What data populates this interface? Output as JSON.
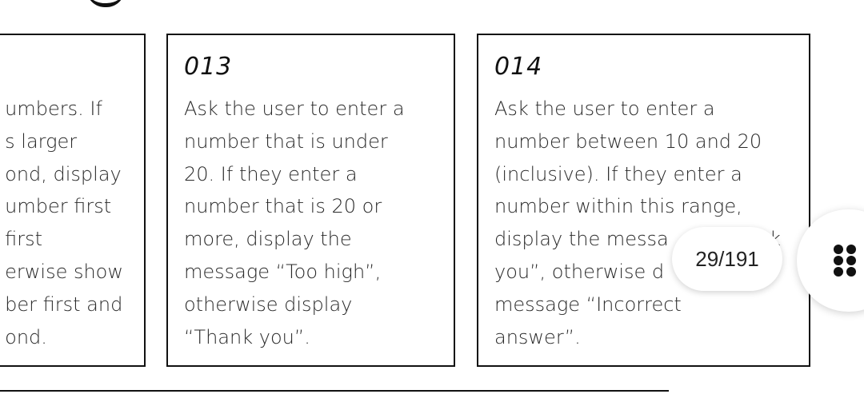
{
  "cards": [
    {
      "number": "",
      "lines": [
        "umbers. If",
        "s larger",
        "ond, display",
        "umber first",
        "first",
        "erwise show",
        "ber first and",
        "ond."
      ]
    },
    {
      "number": "013",
      "lines": [
        "Ask the user to enter a",
        "number that is under",
        "20. If they enter a",
        "number that is 20 or",
        "more, display the",
        "message “Too high”,",
        "otherwise display",
        "“Thank you”."
      ]
    },
    {
      "number": "014",
      "lines": [
        "Ask the user to enter a",
        "number between 10 and 20",
        "(inclusive). If they enter a",
        "number within this range,",
        "display the messa",
        "you”, otherwise d",
        "message “Incorrect",
        "answer”."
      ],
      "partial_fragment": "k"
    }
  ],
  "page_indicator": {
    "text": "29/191"
  },
  "menu_button": {
    "icon": "dots-grid-icon"
  }
}
